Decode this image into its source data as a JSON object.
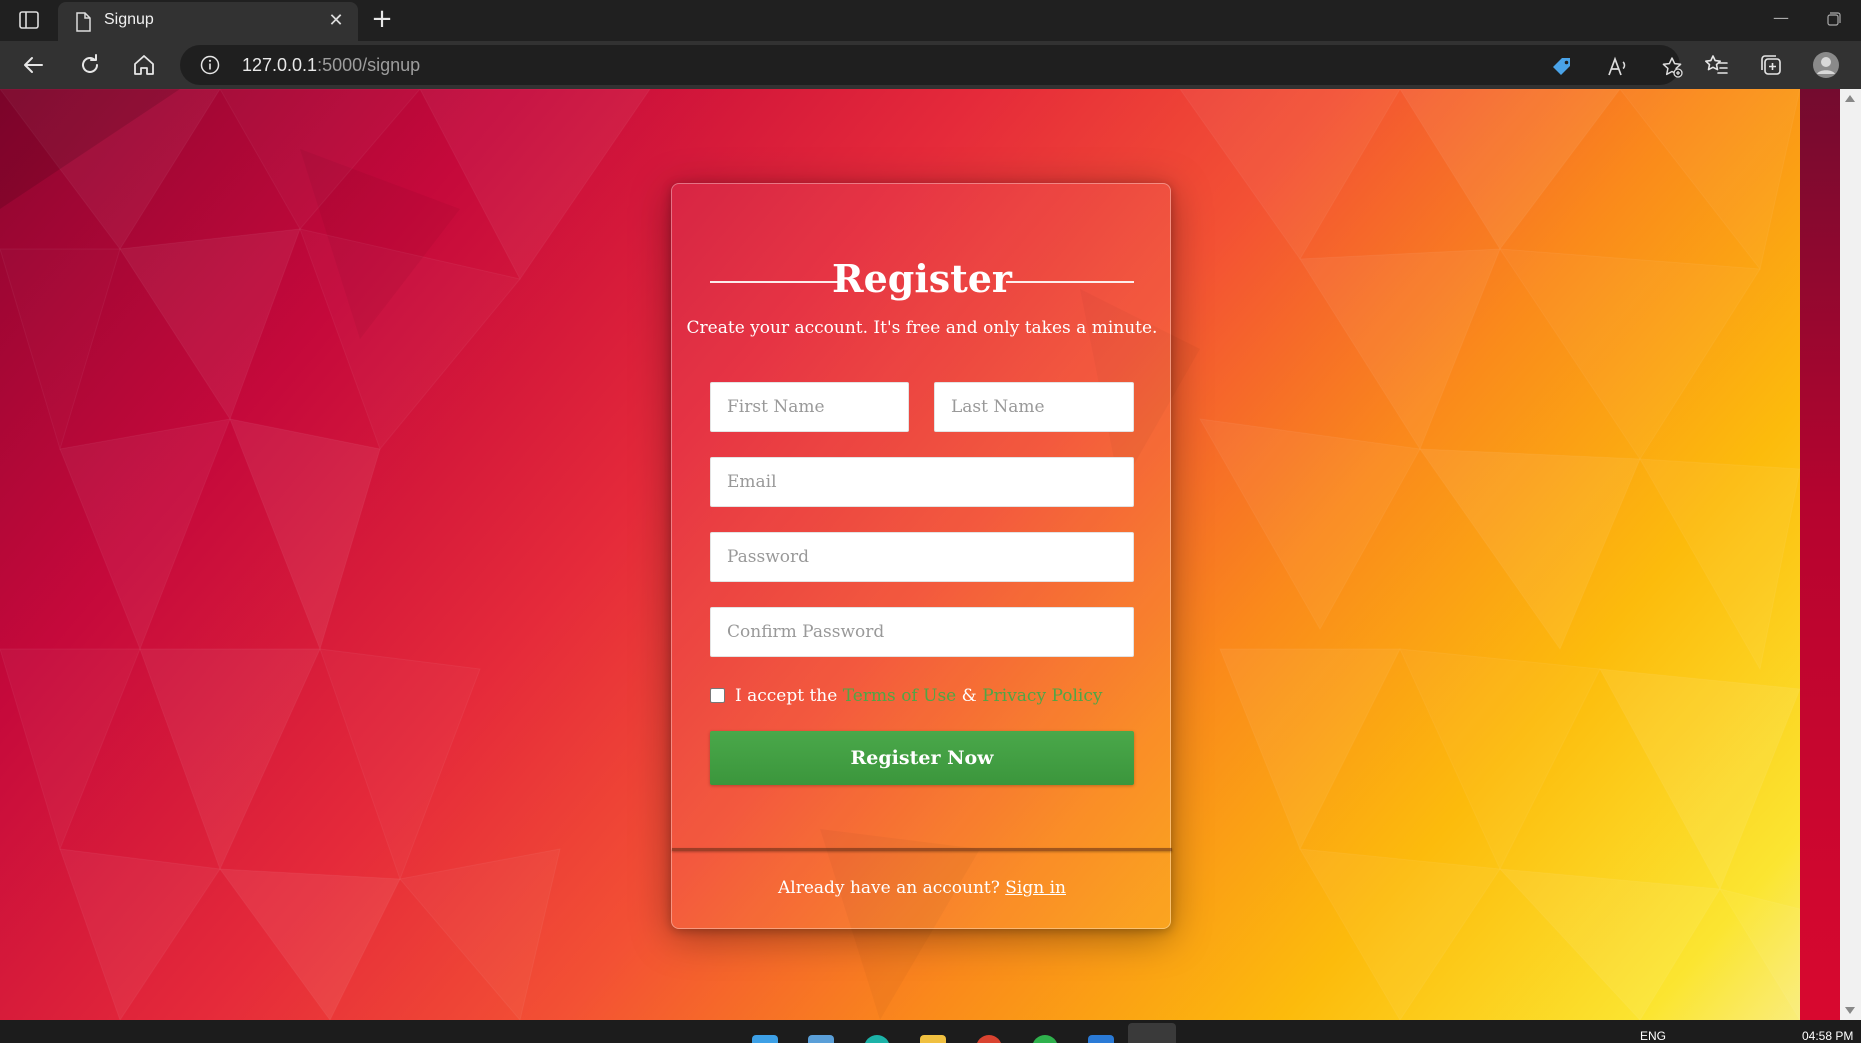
{
  "browser": {
    "tab": {
      "title": "Signup",
      "close_glyph": "✕"
    },
    "new_tab_glyph": "+",
    "minimize_glyph": "—",
    "address": {
      "host": "127.0.0.1",
      "path": ":5000/signup"
    }
  },
  "signup": {
    "title": "Register",
    "subtitle": "Create your account. It's free and only takes a minute.",
    "fields": {
      "first_name_placeholder": "First Name",
      "last_name_placeholder": "Last Name",
      "email_placeholder": "Email",
      "password_placeholder": "Password",
      "confirm_password_placeholder": "Confirm Password"
    },
    "terms": {
      "prefix": "I accept the",
      "terms_link": "Terms of Use",
      "ampersand": "&",
      "privacy_link": "Privacy Policy"
    },
    "submit_label": "Register Now",
    "signin_prompt": "Already have an account?",
    "signin_link": "Sign in"
  },
  "taskbar": {
    "language": "ENG",
    "clock": "04:58 PM"
  },
  "colors": {
    "accent_green": "#3b963c",
    "link_green": "#4fa646",
    "gradient_top": "#c5093b",
    "gradient_bottom": "#fbe531"
  },
  "icons": [
    "sidebar-toggle-icon",
    "page-icon",
    "back-icon",
    "refresh-icon",
    "home-icon",
    "info-icon",
    "shopping-tag-icon",
    "read-aloud-icon",
    "add-favorite-icon",
    "favorites-icon",
    "collections-icon",
    "profile-icon"
  ]
}
